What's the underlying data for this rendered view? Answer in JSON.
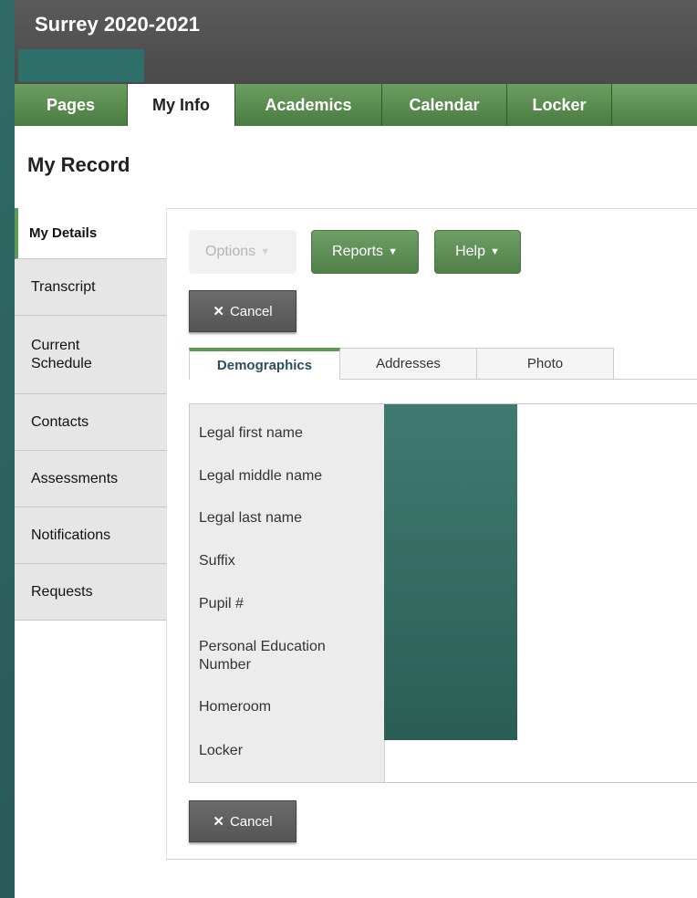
{
  "header": {
    "title": "Surrey 2020-2021"
  },
  "nav": {
    "tabs": [
      {
        "label": "Pages"
      },
      {
        "label": "My Info"
      },
      {
        "label": "Academics"
      },
      {
        "label": "Calendar"
      },
      {
        "label": "Locker"
      }
    ],
    "active": "My Info"
  },
  "page": {
    "title": "My Record"
  },
  "sidebar": {
    "items": [
      {
        "label": "My Details"
      },
      {
        "label": "Transcript"
      },
      {
        "label": "Current Schedule"
      },
      {
        "label": "Contacts"
      },
      {
        "label": "Assessments"
      },
      {
        "label": "Notifications"
      },
      {
        "label": "Requests"
      }
    ],
    "active": "My Details"
  },
  "toolbar": {
    "options_label": "Options",
    "reports_label": "Reports",
    "help_label": "Help",
    "cancel_label": "Cancel"
  },
  "tabs": [
    {
      "label": "Demographics"
    },
    {
      "label": "Addresses"
    },
    {
      "label": "Photo"
    }
  ],
  "form": {
    "labels": [
      "Legal first name",
      "Legal middle name",
      "Legal last name",
      "Suffix",
      "Pupil #",
      "Personal Education Number",
      "Homeroom",
      "Locker"
    ]
  },
  "colors": {
    "header_bg": "#4f4f4f",
    "nav_green": "#5e8f55",
    "accent_green": "#5e9a54",
    "background_teal": "#2b5e5c"
  }
}
